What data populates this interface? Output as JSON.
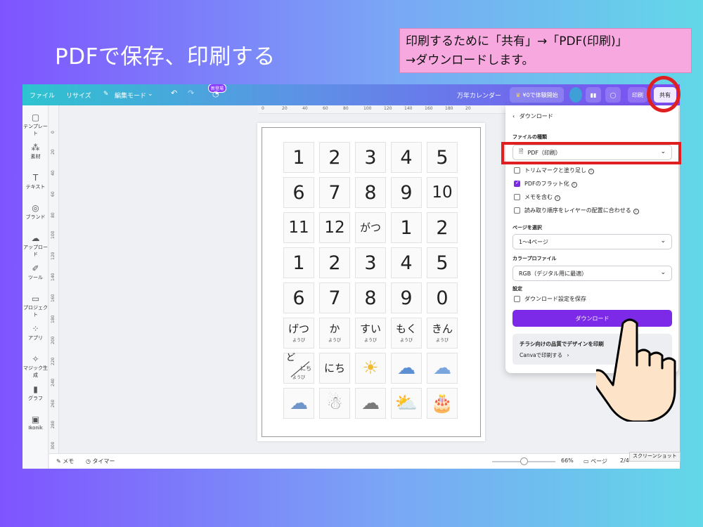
{
  "slide": {
    "title": "PDFで保存、印刷する",
    "note_line1": "印刷するために「共有」→「PDF(印刷)」",
    "note_line2": "→ダウンロードします。"
  },
  "topbar": {
    "file": "ファイル",
    "resize": "リサイズ",
    "edit_mode": "編集モード",
    "new_badge": "新登場",
    "doc_title": "万年カレンダー",
    "trial": "¥0で体験開始",
    "print": "印刷",
    "share": "共有"
  },
  "sidebar": {
    "items": [
      {
        "label": "テンプレート",
        "icon": "template-icon"
      },
      {
        "label": "素材",
        "icon": "elements-icon"
      },
      {
        "label": "テキスト",
        "icon": "text-icon"
      },
      {
        "label": "ブランド",
        "icon": "brand-icon"
      },
      {
        "label": "アップロード",
        "icon": "upload-icon"
      },
      {
        "label": "ツール",
        "icon": "draw-icon"
      },
      {
        "label": "プロジェクト",
        "icon": "folder-icon"
      },
      {
        "label": "アプリ",
        "icon": "apps-icon"
      },
      {
        "label": "マジック生成",
        "icon": "magic-icon"
      },
      {
        "label": "グラフ",
        "icon": "chart-icon"
      },
      {
        "label": "Ikonik",
        "icon": "ikonik-icon"
      }
    ]
  },
  "ruler": {
    "h": [
      "0",
      "20",
      "40",
      "60",
      "80",
      "100",
      "120",
      "140",
      "160",
      "180",
      "20"
    ],
    "v": [
      "0",
      "20",
      "40",
      "60",
      "80",
      "100",
      "120",
      "140",
      "160",
      "180",
      "200",
      "220",
      "240",
      "260",
      "280",
      "300"
    ]
  },
  "calendar": {
    "row1": [
      "1",
      "2",
      "3",
      "4",
      "5"
    ],
    "row2": [
      "6",
      "7",
      "8",
      "9",
      "10"
    ],
    "row3": [
      "11",
      "12",
      "がつ",
      "1",
      "2"
    ],
    "row4": [
      "1",
      "2",
      "3",
      "4",
      "5"
    ],
    "row5": [
      "6",
      "7",
      "8",
      "9",
      "0"
    ],
    "weekdays": [
      {
        "main": "げつ",
        "sub": "ようび"
      },
      {
        "main": "か",
        "sub": "ようび"
      },
      {
        "main": "すい",
        "sub": "ようび"
      },
      {
        "main": "もく",
        "sub": "ようび"
      },
      {
        "main": "きん",
        "sub": "ようび"
      }
    ],
    "do_top": "ど",
    "nichi_small": "にち",
    "yobi_small": "ようび",
    "nichi": "にち"
  },
  "panel": {
    "back": "ダウンロード",
    "file_type_label": "ファイルの種類",
    "file_type_value": "PDF（印刷）",
    "options": [
      {
        "label": "トリムマークと塗り足し",
        "checked": false
      },
      {
        "label": "PDFのフラット化",
        "checked": true
      },
      {
        "label": "メモを含む",
        "checked": false
      },
      {
        "label": "読み取り順序をレイヤーの配置に合わせる",
        "checked": false
      }
    ],
    "page_label": "ページを選択",
    "page_value": "1〜4ページ",
    "color_label": "カラープロファイル",
    "color_value": "RGB（デジタル用に最適）",
    "settings_label": "設定",
    "save_settings": "ダウンロード設定を保存",
    "download_button": "ダウンロード",
    "promo_title": "チラシ向けの品質でデザインを印刷",
    "promo_link": "Canvaで印刷する"
  },
  "bottombar": {
    "memo": "メモ",
    "timer": "タイマー",
    "zoom": "66%",
    "pages": "ページ",
    "page_count": "2/4"
  },
  "screenshot_tag": "スクリーンショット",
  "colors": {
    "accent": "#7d2ae8",
    "highlight": "#e02020",
    "note_bg": "#f7a8df"
  }
}
